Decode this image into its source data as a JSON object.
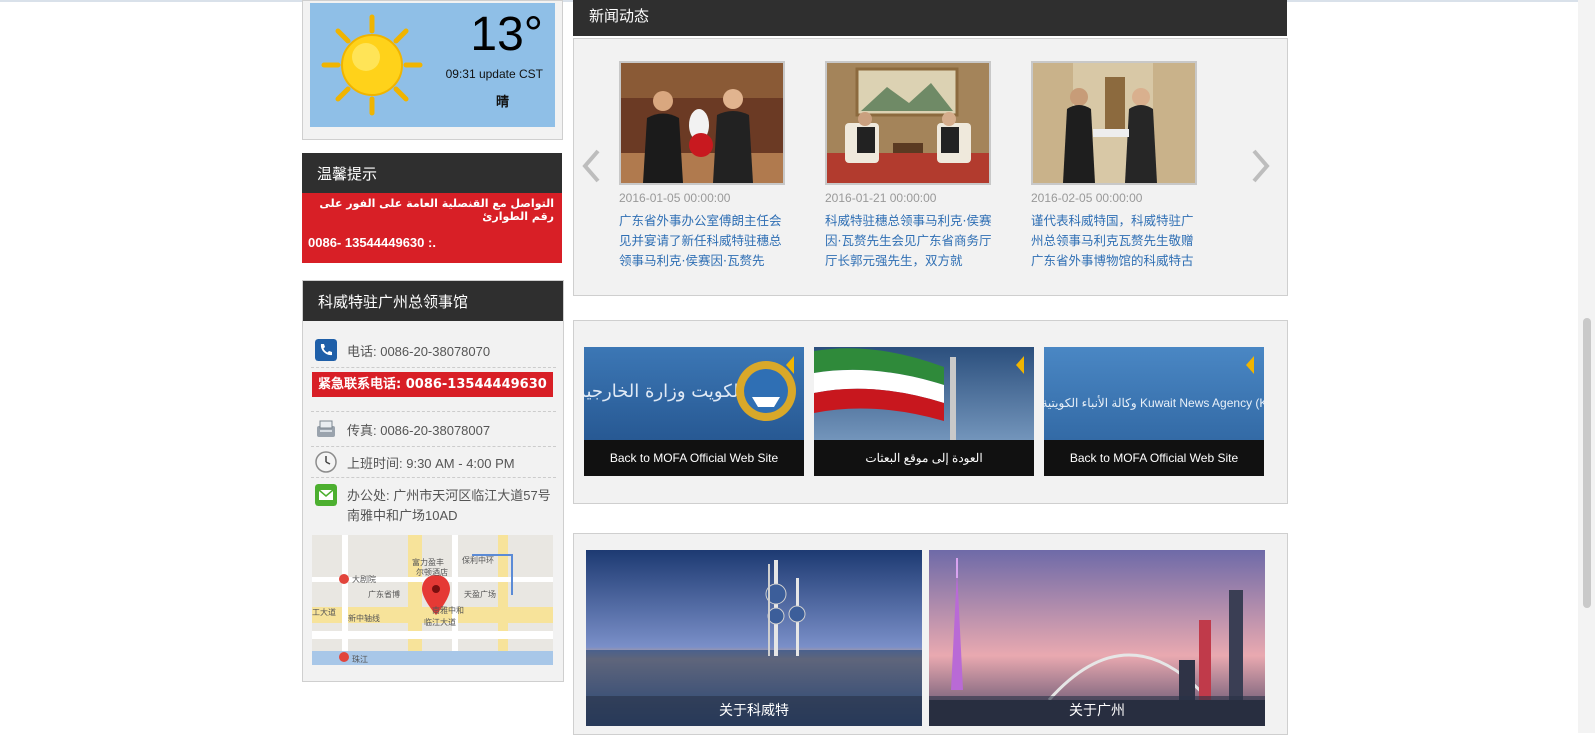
{
  "weather": {
    "temperature": "13°",
    "update": "09:31 update CST",
    "condition": "晴",
    "icon": "sun-icon"
  },
  "tips": {
    "title": "温馨提示",
    "arabic_text": "التواصل مع القنصلية العامة على الفور على رقم الطوارئ",
    "phone": "0086- 13544449630 :."
  },
  "consulate": {
    "title": "科威特驻广州总领事馆",
    "tel": "电话: 0086-20-38078070",
    "emergency": "紧急联系电话: 0086-13544449630",
    "fax": "传真: 0086-20-38078007",
    "hours": "上班时间: 9:30 AM - 4:00 PM",
    "office_line1": "办公处: 广州市天河区临江大道57号",
    "office_line2": "南雅中和广场10AD",
    "map_labels": [
      "大剧院",
      "广东省博",
      "保利中环",
      "天盈广场",
      "富力盈丰",
      "尔顿酒店",
      "南雅中和",
      "临江大道",
      "新中轴线",
      "工大道",
      "珠江"
    ]
  },
  "news": {
    "title": "新闻动态",
    "items": [
      {
        "date": "2016-01-05 00:00:00",
        "title": "广东省外事办公室傅朗主任会见并宴请了新任科威特驻穗总领事马利克·侯赛因·瓦赘先"
      },
      {
        "date": "2016-01-21 00:00:00",
        "title": "科威特驻穗总领事马利克·侯赛因·瓦赘先生会见广东省商务厅厅长郭元强先生，双方就"
      },
      {
        "date": "2016-02-05 00:00:00",
        "title": "谨代表科威特国，科威特驻广州总领事马利克瓦赘先生敬赠广东省外事博物馆的科威特古"
      }
    ]
  },
  "banners": [
    {
      "label": "Back to MOFA Official Web Site",
      "art": "دولة الكويت وزارة الخارجية"
    },
    {
      "label": "العودة إلى موقع البعثات",
      "art": ""
    },
    {
      "label": "Back to MOFA Official Web Site",
      "art": "وكالة الأنباء الكويتية (كونا) Kuwait News Agency (KUNA)"
    }
  ],
  "about": {
    "kuwait": "关于科威特",
    "guangzhou": "关于广州"
  },
  "colors": {
    "dark_header": "#2f2f2f",
    "alert_red": "#d81f26",
    "link_blue": "#2f6fb4",
    "weather_bg": "#8fbfe7"
  }
}
